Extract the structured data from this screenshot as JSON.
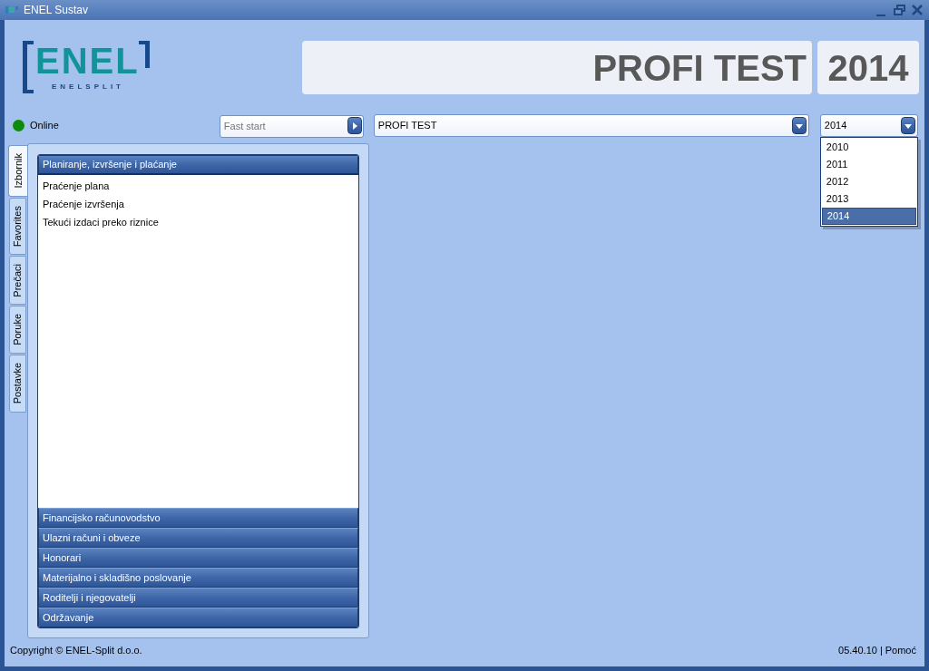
{
  "window": {
    "title": "ENEL Sustav"
  },
  "logo": {
    "wordmark": "ENEL",
    "tagline": "ENELSPLIT"
  },
  "header": {
    "title": "PROFI TEST",
    "year": "2014"
  },
  "status": {
    "label": "Online",
    "online": true
  },
  "fast_start": {
    "placeholder": "Fast start"
  },
  "program_select": {
    "value": "PROFI TEST"
  },
  "year_select": {
    "value": "2014",
    "expanded": true,
    "options": [
      {
        "label": "2010",
        "selected": false
      },
      {
        "label": "2011",
        "selected": false
      },
      {
        "label": "2012",
        "selected": false
      },
      {
        "label": "2013",
        "selected": false
      },
      {
        "label": "2014",
        "selected": true
      }
    ]
  },
  "side_tabs": [
    {
      "label": "Izbornik",
      "selected": true
    },
    {
      "label": "Favorites",
      "selected": false
    },
    {
      "label": "Prečaci",
      "selected": false
    },
    {
      "label": "Poruke",
      "selected": false
    },
    {
      "label": "Postavke",
      "selected": false
    }
  ],
  "menu_groups": [
    {
      "label": "Planiranje, izvršenje i plaćanje",
      "expanded": true,
      "children": [
        {
          "label": "Praćenje plana"
        },
        {
          "label": "Praćenje izvršenja"
        },
        {
          "label": "Tekući izdaci preko riznice"
        }
      ]
    },
    {
      "label": "Financijsko računovodstvo",
      "expanded": false
    },
    {
      "label": "Ulazni računi i obveze",
      "expanded": false
    },
    {
      "label": "Honorari",
      "expanded": false
    },
    {
      "label": "Materijalno i skladišno poslovanje",
      "expanded": false
    },
    {
      "label": "Roditelji i njegovatelji",
      "expanded": false
    },
    {
      "label": "Održavanje",
      "expanded": false
    }
  ],
  "footer": {
    "copyright": "Copyright © ENEL-Split d.o.o.",
    "version": "05.40.10",
    "separator": "|",
    "help_link": "Pomoć"
  }
}
